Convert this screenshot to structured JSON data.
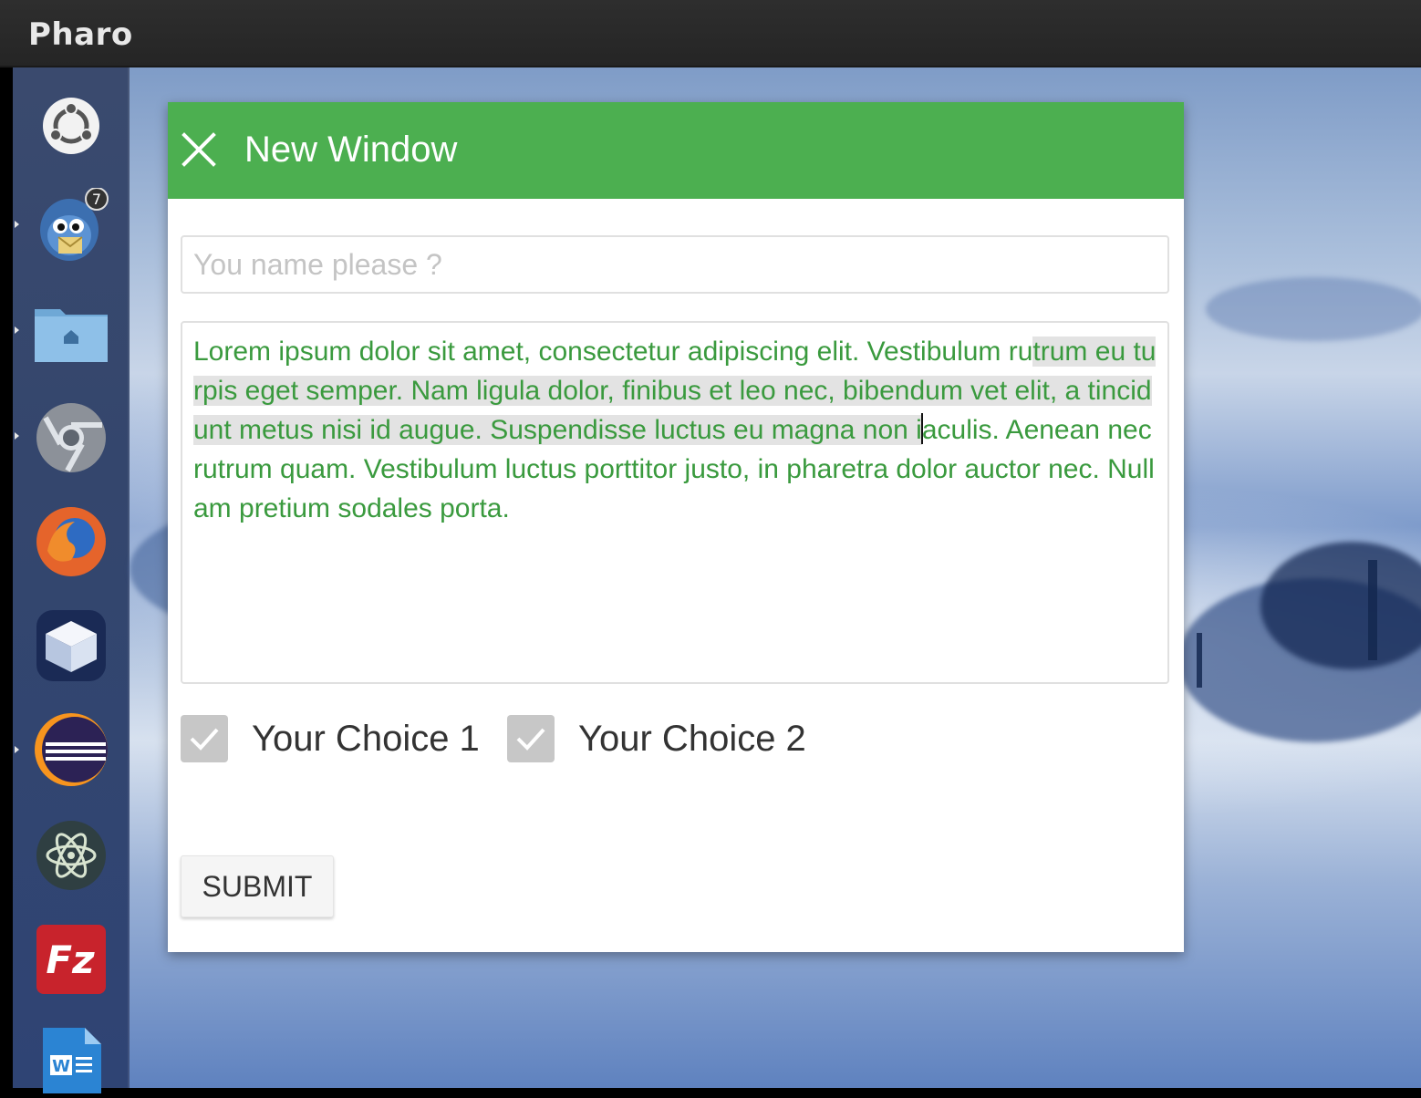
{
  "app": {
    "title": "Pharo"
  },
  "launcher": {
    "items": [
      {
        "icon": "ubuntu-dash-icon"
      },
      {
        "icon": "mail-bird-icon",
        "badge": "7"
      },
      {
        "icon": "home-folder-icon"
      },
      {
        "icon": "chrome-icon"
      },
      {
        "icon": "firefox-icon"
      },
      {
        "icon": "box-cube-icon"
      },
      {
        "icon": "eclipse-icon"
      },
      {
        "icon": "atom-icon"
      },
      {
        "icon": "filezilla-icon",
        "label": "Fz"
      },
      {
        "icon": "writer-doc-icon",
        "label": "W"
      }
    ]
  },
  "window": {
    "title": "New Window",
    "name_placeholder": "You name please ?",
    "text_before_sel": "Lorem ipsum dolor sit amet, consectetur adipiscing elit. Vestibulum ru",
    "text_selected_before_caret": "trum eu turpis eget semper. Nam ligula dolor, finibus et leo nec, bibendum vet elit, a tincidunt metus nisi id augue. Suspendisse luctus eu magna non i",
    "text_after_caret": "aculis. Aenean nec rutrum quam. Vestibulum luctus porttitor justo, in pharetra dolor auctor nec. Nullam pretium sodales porta.",
    "choices": [
      {
        "label": "Your Choice 1",
        "checked": true
      },
      {
        "label": "Your Choice 2",
        "checked": true
      }
    ],
    "submit_label": "SUBMIT"
  },
  "colors": {
    "header_green": "#4caf50",
    "text_green": "#3a9a3e",
    "checkbox_gray": "#c7c7c7"
  }
}
